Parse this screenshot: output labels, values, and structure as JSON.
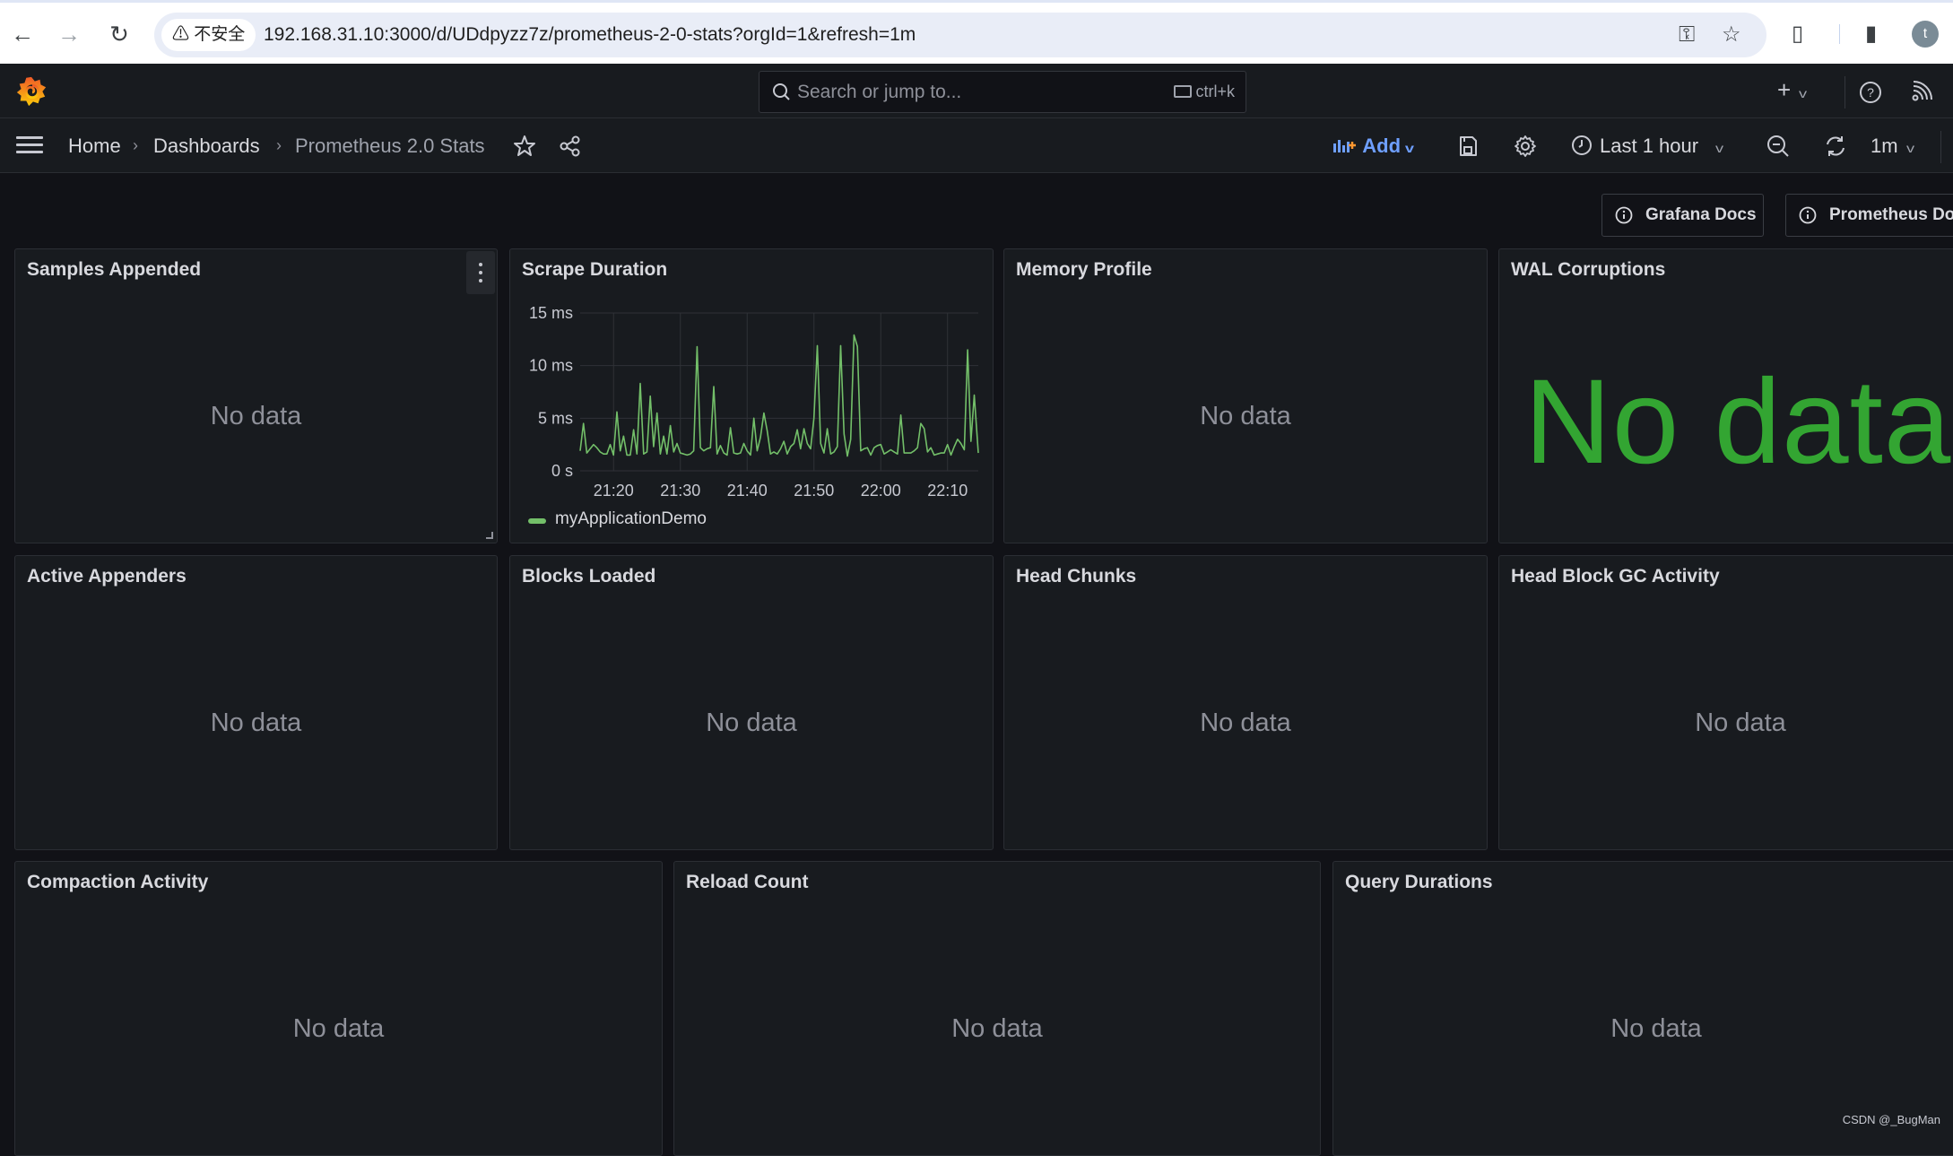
{
  "browser": {
    "security_label": "不安全",
    "url": "192.168.31.10:3000/d/UDdpyzz7z/prometheus-2-0-stats?orgId=1&refresh=1m",
    "profile_initial": "t"
  },
  "topbar": {
    "search_placeholder": "Search or jump to...",
    "search_shortcut": "ctrl+k"
  },
  "breadcrumb": {
    "items": [
      "Home",
      "Dashboards",
      "Prometheus 2.0 Stats"
    ],
    "separator": "›"
  },
  "toolbar": {
    "add_label": "Add",
    "time_range": "Last 1 hour",
    "refresh_interval": "1m"
  },
  "dashboard_links": [
    {
      "label": "Grafana Docs"
    },
    {
      "label": "Prometheus Docs"
    }
  ],
  "colors": {
    "accent_blue": "#6e9fff",
    "series_green": "#73bf69",
    "stat_green": "#33a532"
  },
  "panels": [
    {
      "title": "Samples Appended",
      "nodata": "No data"
    },
    {
      "title": "Scrape Duration"
    },
    {
      "title": "Memory Profile",
      "nodata": "No data"
    },
    {
      "title": "WAL Corruptions",
      "nodata": "No data"
    },
    {
      "title": "Active Appenders",
      "nodata": "No data"
    },
    {
      "title": "Blocks Loaded",
      "nodata": "No data"
    },
    {
      "title": "Head Chunks",
      "nodata": "No data"
    },
    {
      "title": "Head Block GC Activity",
      "nodata": "No data"
    },
    {
      "title": "Compaction Activity",
      "nodata": "No data"
    },
    {
      "title": "Reload Count",
      "nodata": "No data"
    },
    {
      "title": "Query Durations",
      "nodata": "No data"
    }
  ],
  "chart_data": {
    "type": "line",
    "title": "Scrape Duration",
    "xlabel": "",
    "ylabel": "",
    "x_unit": "minutes since 21:15",
    "xlim": [
      0,
      59.6
    ],
    "ylim": [
      0,
      15
    ],
    "y_unit": "ms",
    "yticks": [
      0,
      5,
      10,
      15
    ],
    "ytick_labels": [
      "0 s",
      "5 ms",
      "10 ms",
      "15 ms"
    ],
    "xticks": [
      5,
      15,
      25,
      35,
      45,
      55
    ],
    "xtick_labels": [
      "21:20",
      "21:30",
      "21:40",
      "21:50",
      "22:00",
      "22:10"
    ],
    "grid": true,
    "legend": "bottom-left",
    "series": [
      {
        "name": "myApplicationDemo",
        "color": "#73bf69",
        "x": [
          0,
          0.5,
          1,
          1.5,
          2,
          2.5,
          3,
          3.5,
          4,
          4.5,
          5,
          5.5,
          6,
          6.5,
          7,
          7.5,
          8,
          8.5,
          9,
          9.5,
          10,
          10.5,
          11,
          11.5,
          12,
          12.5,
          13,
          13.5,
          14,
          14.5,
          15,
          15.5,
          16,
          16.5,
          17,
          17.5,
          18,
          18.5,
          19,
          19.5,
          20,
          20.5,
          21,
          21.5,
          22,
          22.5,
          23,
          23.5,
          24,
          24.5,
          25,
          25.5,
          26,
          26.5,
          27,
          27.5,
          28,
          28.5,
          29,
          29.5,
          30,
          30.5,
          31,
          31.5,
          32,
          32.5,
          33,
          33.5,
          34,
          34.5,
          35,
          35.5,
          36,
          36.5,
          37,
          37.5,
          38,
          38.5,
          39,
          39.5,
          40,
          40.5,
          41,
          41.5,
          42,
          42.5,
          43,
          43.5,
          44,
          44.5,
          45,
          45.5,
          46,
          46.5,
          47,
          47.5,
          48,
          48.5,
          49,
          49.5,
          50,
          50.5,
          51,
          51.5,
          52,
          52.5,
          53,
          53.5,
          54,
          54.5,
          55,
          55.5,
          56,
          56.5,
          57,
          57.5,
          58,
          58.5,
          59,
          59.6
        ],
        "values": [
          1.9,
          4.5,
          1.7,
          2.1,
          2.5,
          2.2,
          1.8,
          1.6,
          1.6,
          2.5,
          1.5,
          5.6,
          1.9,
          3.3,
          1.5,
          1.5,
          3.9,
          1.6,
          8.3,
          1.6,
          1.8,
          7.1,
          2.3,
          5.5,
          1.6,
          3.3,
          1.6,
          4.3,
          1.8,
          2.6,
          1.7,
          1.6,
          1.5,
          1.6,
          1.9,
          11.8,
          2.2,
          1.9,
          2.1,
          2.2,
          8.0,
          1.6,
          2.4,
          1.7,
          1.5,
          4.1,
          1.7,
          1.6,
          1.7,
          2.6,
          1.9,
          1.5,
          5.0,
          1.9,
          3.2,
          5.5,
          3.8,
          1.6,
          1.8,
          1.6,
          2.1,
          2.8,
          1.6,
          2.3,
          2.6,
          3.9,
          2.1,
          4.0,
          2.6,
          2.1,
          5.0,
          11.9,
          2.6,
          1.7,
          4.0,
          1.6,
          1.8,
          2.3,
          11.9,
          3.5,
          1.4,
          3.0,
          12.9,
          11.8,
          1.9,
          2.1,
          2.2,
          1.5,
          2.2,
          2.4,
          2.5,
          1.6,
          1.8,
          2.0,
          1.8,
          1.6,
          5.3,
          1.7,
          1.7,
          1.7,
          1.9,
          2.2,
          4.5,
          4.0,
          1.8,
          2.2,
          1.5,
          1.6,
          1.7,
          1.7,
          2.5,
          1.5,
          2.3,
          3.0,
          2.6,
          2.0,
          11.5,
          2.8,
          7.2,
          1.7
        ]
      }
    ]
  },
  "watermark": "CSDN @_BugMan"
}
